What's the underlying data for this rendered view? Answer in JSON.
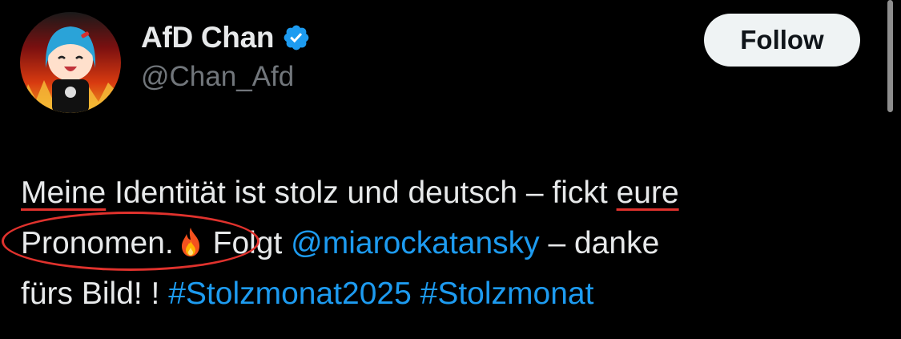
{
  "author": {
    "display_name": "AfD Chan",
    "handle": "@Chan_Afd",
    "verified": true,
    "avatar_icon": "anime-avatar"
  },
  "follow_button": {
    "label": "Follow"
  },
  "tweet": {
    "line1": {
      "word1": "Meine",
      "text_middle": " Identität ist stolz und deutsch – fickt ",
      "word2": "eure"
    },
    "line2": {
      "word1": "Pronomen.",
      "text_middle": "  Folgt ",
      "mention": "@miarockatansky",
      "text_end": "  – danke"
    },
    "line3": {
      "text_start": "fürs Bild! !  ",
      "hashtag1": "#Stolzmonat2025",
      "hashtag2": "#Stolzmonat"
    }
  },
  "colors": {
    "background": "#000000",
    "text_primary": "#e7e9ea",
    "text_secondary": "#71767b",
    "link": "#1d9bf0",
    "annotation": "#e0322d",
    "button_bg": "#eff3f4"
  },
  "icons": [
    "verified-icon",
    "fire-icon"
  ]
}
